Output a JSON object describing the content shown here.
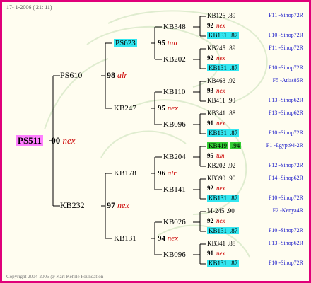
{
  "header": "17- 1-2006 ( 21: 11)",
  "footer": "Copyright 2004-2006 @ Karl Kehrle Foundation",
  "colors": {
    "border": "#e0007a",
    "background": "#fffdf0",
    "highlight_cyan": "#33e6f0",
    "highlight_pink": "#ff80ff",
    "highlight_green": "#33cc33",
    "prefix_red": "#cc0000",
    "right_blue": "#1a1ac8"
  },
  "g1": {
    "name": "PS511",
    "count": "00",
    "prefix": "nex"
  },
  "g2": [
    {
      "name": "PS610",
      "count": "98",
      "prefix": "alr"
    },
    {
      "name": "KB232",
      "count": "97",
      "prefix": "nex"
    }
  ],
  "g3": [
    {
      "name": "PS623",
      "count": "95",
      "prefix": "tun"
    },
    {
      "name": "KB247",
      "count": "95",
      "prefix": "nex"
    },
    {
      "name": "KB178",
      "count": "96",
      "prefix": "alr"
    },
    {
      "name": "KB131",
      "count": "94",
      "prefix": "nex"
    }
  ],
  "g4": [
    {
      "name": "KB348"
    },
    {
      "name": "KB202"
    },
    {
      "name": "KB110"
    },
    {
      "name": "KB096"
    },
    {
      "name": "KB204"
    },
    {
      "name": "KB141"
    },
    {
      "name": "KB026"
    },
    {
      "name": "KB096"
    }
  ],
  "g5": [
    {
      "name": "KB126",
      "val": ".89",
      "c": "92",
      "p": "nex",
      "name2": "KB131",
      "val2": ".87"
    },
    {
      "name": "KB245",
      "val": ".89",
      "c": "92",
      "p": "nex",
      "name2": "KB131",
      "val2": ".87"
    },
    {
      "name": "KB468",
      "val": ".92",
      "c": "93",
      "p": "nex",
      "name2": "KB411",
      "val2": ".90"
    },
    {
      "name": "KB341",
      "val": ".88",
      "c": "91",
      "p": "nex",
      "name2": "KB131",
      "val2": ".87"
    },
    {
      "name": "KB419",
      "val": ".94",
      "c": "95",
      "p": "tun",
      "name2": "KB202",
      "val2": ".92"
    },
    {
      "name": "KB390",
      "val": ".90",
      "c": "92",
      "p": "nex",
      "name2": "KB131",
      "val2": ".87"
    },
    {
      "name": "M-245",
      "val": ".90",
      "c": "92",
      "p": "nex",
      "name2": "KB131",
      "val2": ".87"
    },
    {
      "name": "KB341",
      "val": ".88",
      "c": "91",
      "p": "nex",
      "name2": "KB131",
      "val2": ".87"
    }
  ],
  "right": [
    "F11 -Sinop72R",
    "F10 -Sinop72R",
    "F11 -Sinop72R",
    "F10 -Sinop72R",
    "F5 -Atlas85R",
    "F13 -Sinop62R",
    "F13 -Sinop62R",
    "F10 -Sinop72R",
    "F1 -Egypt94-2R",
    "F12 -Sinop72R",
    "F14 -Sinop62R",
    "F10 -Sinop72R",
    "F2 -Kenya4R",
    "F10 -Sinop72R",
    "F13 -Sinop62R",
    "F10 -Sinop72R"
  ]
}
